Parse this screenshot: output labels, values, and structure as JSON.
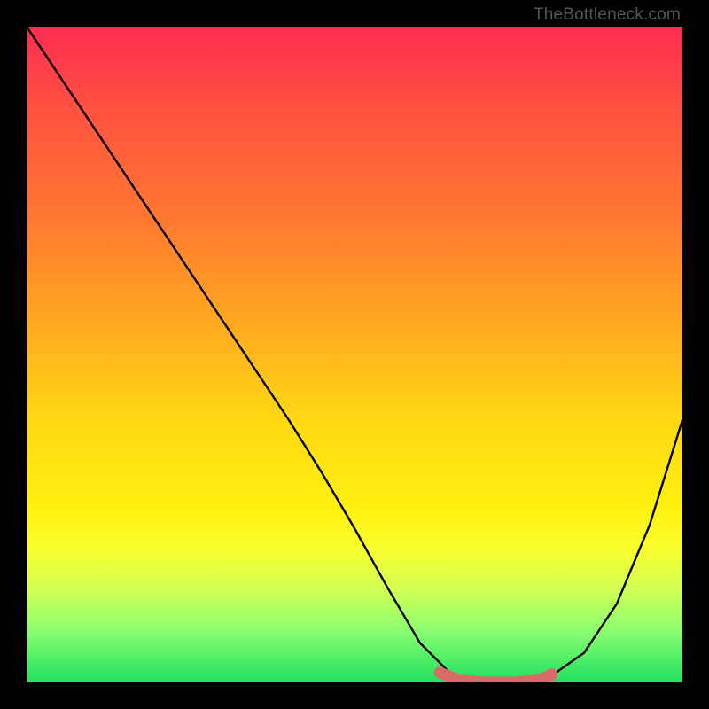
{
  "attribution": "TheBottleneck.com",
  "chart_data": {
    "type": "line",
    "title": "",
    "xlabel": "",
    "ylabel": "",
    "xlim": [
      0,
      1
    ],
    "ylim": [
      0,
      1
    ],
    "x": [
      0.0,
      0.05,
      0.1,
      0.15,
      0.2,
      0.25,
      0.3,
      0.35,
      0.4,
      0.45,
      0.5,
      0.55,
      0.6,
      0.65,
      0.7,
      0.75,
      0.8,
      0.85,
      0.9,
      0.95,
      1.0
    ],
    "values": [
      1.0,
      0.925,
      0.85,
      0.775,
      0.7,
      0.625,
      0.55,
      0.475,
      0.4,
      0.32,
      0.235,
      0.145,
      0.06,
      0.01,
      0.0,
      0.0,
      0.01,
      0.045,
      0.12,
      0.24,
      0.4
    ],
    "marker_segment": {
      "x": [
        0.63,
        0.66,
        0.7,
        0.74,
        0.78,
        0.8
      ],
      "values": [
        0.015,
        0.003,
        0.0,
        0.0,
        0.003,
        0.012
      ]
    },
    "colors": {
      "line": "#000000",
      "marker": "#d96a6a"
    }
  }
}
